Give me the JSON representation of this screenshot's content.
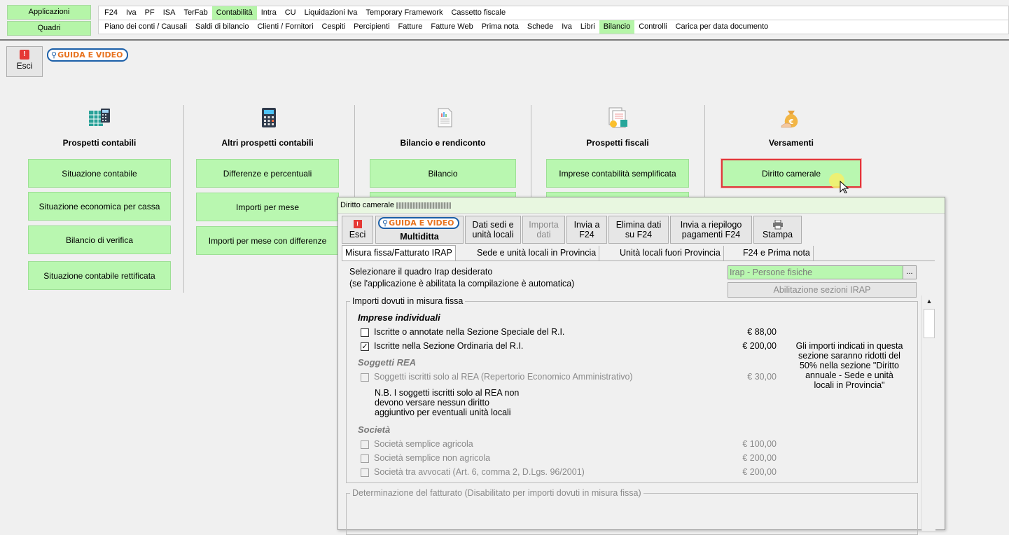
{
  "menu": {
    "side_buttons": [
      "Applicazioni",
      "Quadri"
    ],
    "row1": [
      "F24",
      "Iva",
      "PF",
      "ISA",
      "TerFab",
      "Contabilità",
      "Intra",
      "CU",
      "Liquidazioni Iva",
      "Temporary Framework",
      "Cassetto fiscale"
    ],
    "row1_active": "Contabilità",
    "row2": [
      "Piano dei conti / Causali",
      "Saldi di bilancio",
      "Clienti / Fornitori",
      "Cespiti",
      "Percipienti",
      "Fatture",
      "Fatture Web",
      "Prima nota",
      "Schede",
      "Iva",
      "Libri",
      "Bilancio",
      "Controlli",
      "Carica per data documento"
    ],
    "row2_active": "Bilancio"
  },
  "toolbar": {
    "esci_label": "Esci",
    "guida_label": "GUIDA E VIDEO"
  },
  "columns": [
    {
      "title": "Prospetti contabili",
      "icon": "spreadsheet-calculator-icon",
      "buttons": [
        "Situazione contabile",
        "Situazione economica per cassa",
        "Bilancio di verifica",
        "Situazione contabile rettificata"
      ]
    },
    {
      "title": "Altri prospetti contabili",
      "icon": "calculator-icon",
      "buttons": [
        "Differenze e percentuali",
        "Importi per mese",
        "Importi per mese con differenze"
      ]
    },
    {
      "title": "Bilancio e rendiconto",
      "icon": "report-document-icon",
      "buttons": [
        "Bilancio"
      ]
    },
    {
      "title": "Prospetti fiscali",
      "icon": "tax-document-icon",
      "buttons": [
        "Imprese contabilità semplificata"
      ]
    },
    {
      "title": "Versamenti",
      "icon": "money-bag-icon",
      "buttons": [
        "Diritto camerale"
      ]
    }
  ],
  "dialog": {
    "title": "Diritto camerale",
    "toolbar": {
      "esci": "Esci",
      "guida": "GUIDA E VIDEO",
      "multiditta": "Multiditta",
      "dati_sedi": [
        "Dati sedi e",
        "unità locali"
      ],
      "importa": [
        "Importa",
        "dati"
      ],
      "invia_f24": [
        "Invia a",
        "F24"
      ],
      "elimina": [
        "Elimina dati",
        "su F24"
      ],
      "riepilogo": [
        "Invia a riepilogo",
        "pagamenti F24"
      ],
      "stampa": "Stampa"
    },
    "tabs": [
      "Misura fissa/Fatturato IRAP",
      "Sede e unità locali in Provincia",
      "Unità locali fuori Provincia",
      "F24 e Prima nota"
    ],
    "select_label_1": "Selezionare il quadro Irap desiderato",
    "select_label_2": "(se l'applicazione è abilitata la compilazione è automatica)",
    "irap_value": "Irap - Persone fisiche",
    "irap_dots": "...",
    "abilitazione": "Abilitazione sezioni IRAP",
    "group_fissa": "Importi dovuti in misura fissa",
    "imprese_title": "Imprese individuali",
    "imprese": [
      {
        "label": "Iscritte o annotate nella Sezione Speciale del R.I.",
        "amount": "€ 88,00",
        "checked": false
      },
      {
        "label": "Iscritte nella Sezione Ordinaria del R.I.",
        "amount": "€ 200,00",
        "checked": true
      }
    ],
    "rea_title": "Soggetti REA",
    "rea_row": {
      "label": "Soggetti iscritti solo al REA (Repertorio Economico Amministrativo)",
      "amount": "€ 30,00"
    },
    "rea_note": [
      "N.B. I soggetti iscritti solo al REA non",
      "devono versare nessun diritto",
      "aggiuntivo per eventuali unità locali"
    ],
    "side_note": [
      "Gli importi indicati in questa",
      "sezione saranno ridotti del",
      "50% nella sezione \"Diritto",
      "annuale - Sede e unità",
      "locali in Provincia\""
    ],
    "societa_title": "Società",
    "societa": [
      {
        "label": "Società semplice agricola",
        "amount": "€ 100,00"
      },
      {
        "label": "Società semplice non agricola",
        "amount": "€ 200,00"
      },
      {
        "label": "Società tra avvocati (Art. 6, comma 2, D.Lgs. 96/2001)",
        "amount": "€ 200,00"
      }
    ],
    "group_fatturato": "Determinazione del fatturato (Disabilitato per importi dovuti in misura fissa)"
  }
}
